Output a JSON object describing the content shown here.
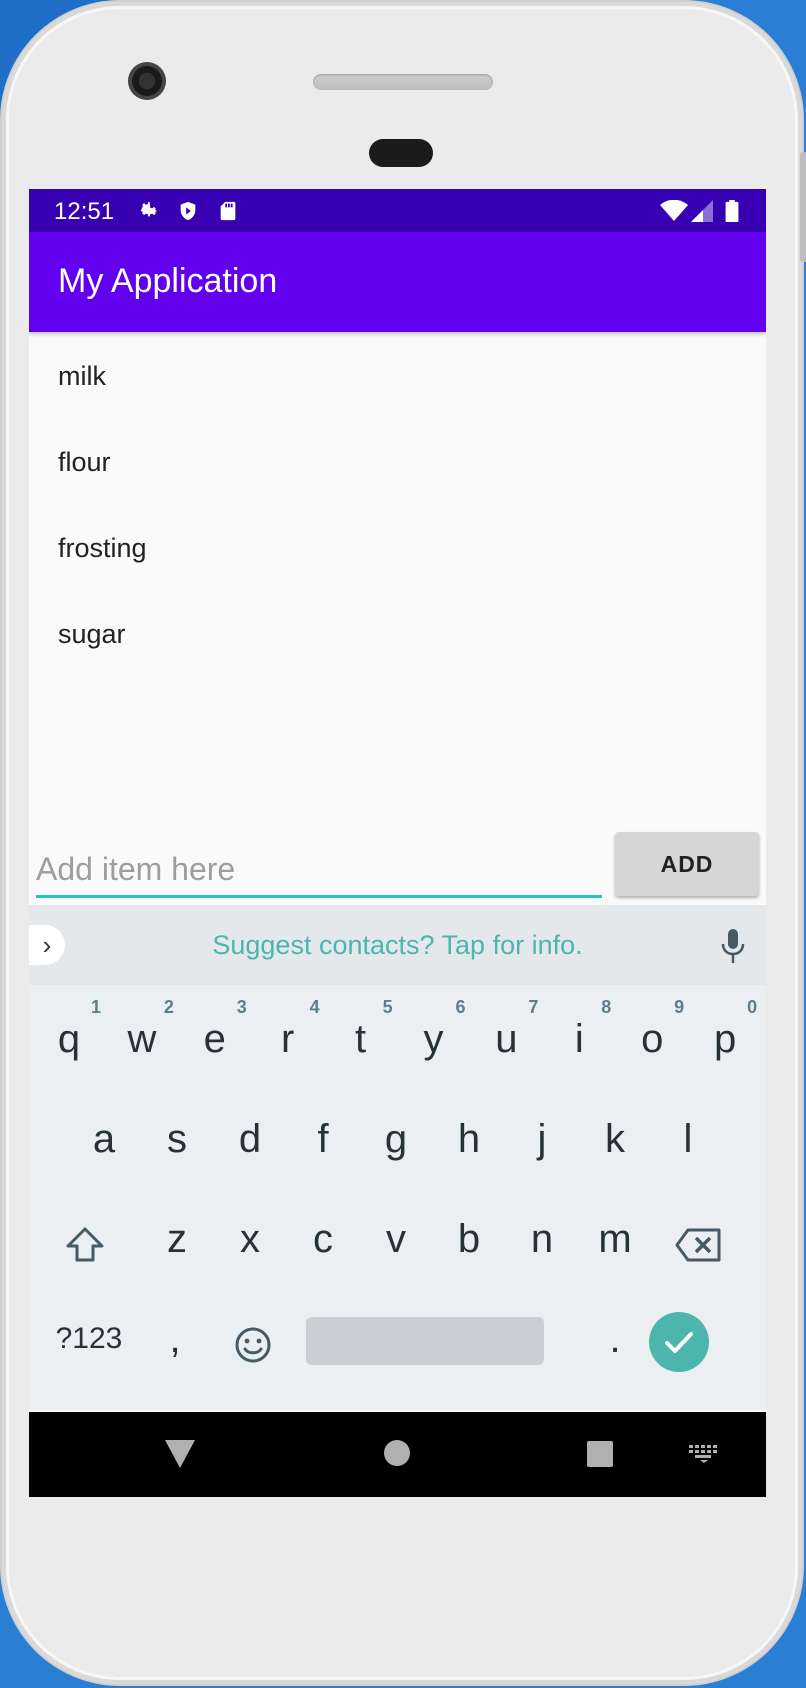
{
  "status_bar": {
    "time": "12:51",
    "left_icons": [
      "gear-icon",
      "shield-icon",
      "sd-card-icon"
    ],
    "right_icons": [
      "wifi-icon",
      "cell-signal-icon",
      "battery-icon"
    ],
    "background": "#3700b3"
  },
  "app_bar": {
    "title": "My Application",
    "background": "#6200ee"
  },
  "list": {
    "items": [
      "milk",
      "flour",
      "frosting",
      "sugar"
    ]
  },
  "input": {
    "placeholder": "Add item here",
    "value": "",
    "accent": "#26c6b6"
  },
  "add_button": {
    "label": "ADD"
  },
  "keyboard": {
    "suggestion": "Suggest contacts? Tap for info.",
    "row1": [
      {
        "k": "q",
        "h": "1"
      },
      {
        "k": "w",
        "h": "2"
      },
      {
        "k": "e",
        "h": "3"
      },
      {
        "k": "r",
        "h": "4"
      },
      {
        "k": "t",
        "h": "5"
      },
      {
        "k": "y",
        "h": "6"
      },
      {
        "k": "u",
        "h": "7"
      },
      {
        "k": "i",
        "h": "8"
      },
      {
        "k": "o",
        "h": "9"
      },
      {
        "k": "p",
        "h": "0"
      }
    ],
    "row2": [
      "a",
      "s",
      "d",
      "f",
      "g",
      "h",
      "j",
      "k",
      "l"
    ],
    "row3": [
      "z",
      "x",
      "c",
      "v",
      "b",
      "n",
      "m"
    ],
    "symbols_label": "?123",
    "comma": ",",
    "period": ".",
    "accent": "#4db6ac"
  },
  "nav_bar": {
    "icons": [
      "back-icon",
      "home-icon",
      "recents-icon",
      "keyboard-switch-icon"
    ]
  }
}
